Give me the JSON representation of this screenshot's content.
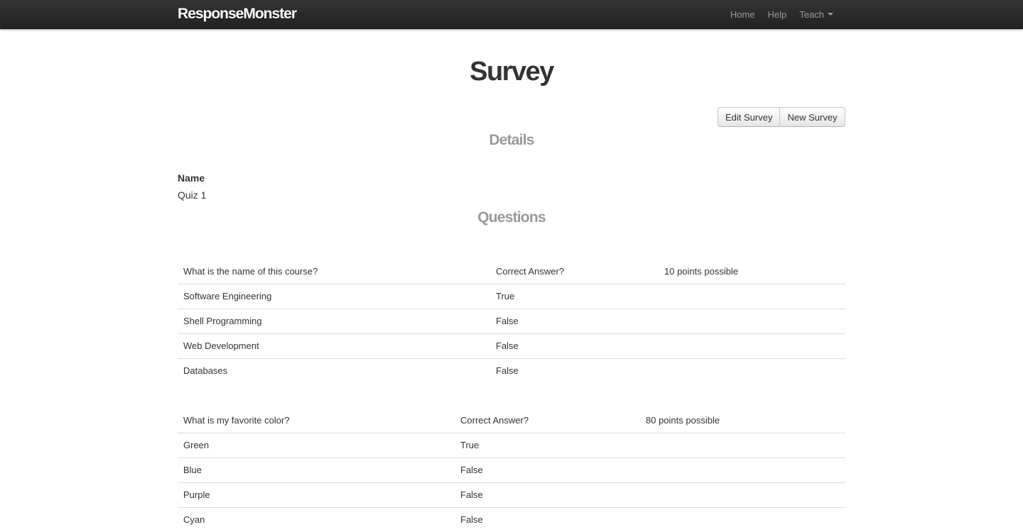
{
  "navbar": {
    "brand": "ResponseMonster",
    "items": [
      {
        "label": "Home"
      },
      {
        "label": "Help"
      },
      {
        "label": "Teach"
      }
    ]
  },
  "page": {
    "title": "Survey",
    "actions": {
      "edit_label": "Edit Survey",
      "new_label": "New Survey"
    },
    "details_heading": "Details",
    "name_label": "Name",
    "name_value": "Quiz 1",
    "questions_heading": "Questions"
  },
  "questions": [
    {
      "question": "What is the name of this course?",
      "correct_header": "Correct Answer?",
      "points": "10 points possible",
      "answers": [
        {
          "text": "Software Engineering",
          "correct": "True"
        },
        {
          "text": "Shell Programming",
          "correct": "False"
        },
        {
          "text": "Web Development",
          "correct": "False"
        },
        {
          "text": "Databases",
          "correct": "False"
        }
      ]
    },
    {
      "question": "What is my favorite color?",
      "correct_header": "Correct Answer?",
      "points": "80 points possible",
      "answers": [
        {
          "text": "Green",
          "correct": "True"
        },
        {
          "text": "Blue",
          "correct": "False"
        },
        {
          "text": "Purple",
          "correct": "False"
        },
        {
          "text": "Cyan",
          "correct": "False"
        }
      ]
    }
  ]
}
